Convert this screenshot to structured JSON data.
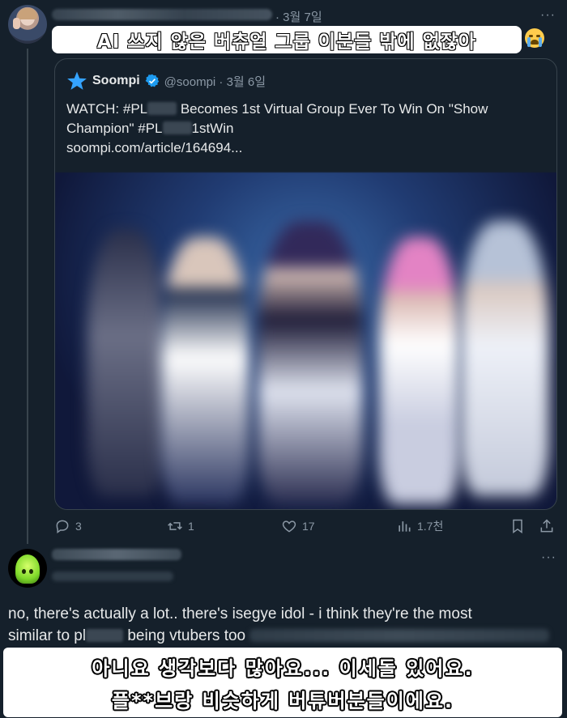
{
  "tweet1": {
    "date": "· 3월 7일",
    "more": "···",
    "caption": "AI 쓰지 않은 버츄얼 그룹 이분들 밖에 없잖아",
    "emoji": "loudly-crying-face",
    "quote": {
      "name": "Soompi",
      "handle": "@soompi · 3월 6일",
      "text_a": "WATCH: #PL",
      "text_b": " Becomes 1st Virtual Group Ever To Win On \"Show Champion\" #PL",
      "text_c": "1stWin",
      "link": "soompi.com/article/164694..."
    },
    "actions": {
      "replies": "3",
      "retweets": "1",
      "likes": "17",
      "views": "1.7천"
    }
  },
  "tweet2": {
    "more": "···",
    "text_line1": "no, there's actually a lot.. there's isegye idol - i think they're the most",
    "text_line2_a": "similar to pl",
    "text_line2_b": " being vtubers too",
    "caption_line1": "아니요 생각보다 많아요... 이세돌 있어요.",
    "caption_line2": "플**브랑 비슷하게 버튜버분들이에요."
  },
  "colors": {
    "background": "#15202b",
    "text": "#e7e9ea",
    "muted": "#8b98a5",
    "border": "#38444d",
    "verified": "#1d9bf0"
  }
}
